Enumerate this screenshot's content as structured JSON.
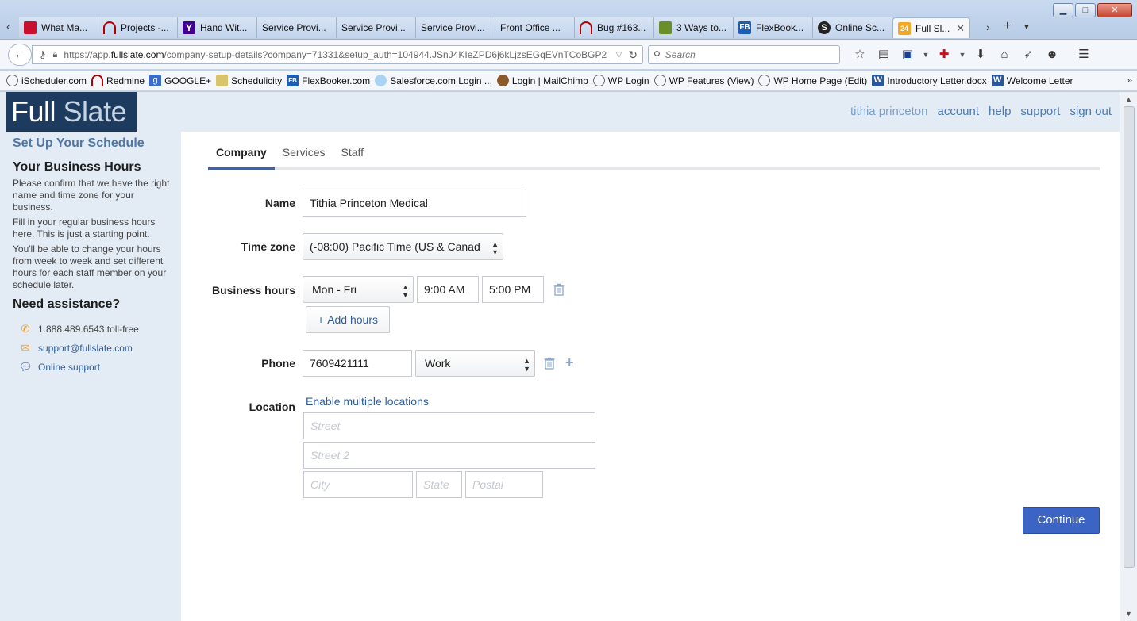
{
  "browser": {
    "tabs": [
      {
        "label": "What Ma...",
        "color": "#c8102e"
      },
      {
        "label": "Projects -...",
        "color": "#b40000"
      },
      {
        "label": "Hand Wit...",
        "color": "#410093"
      },
      {
        "label": "Service Provi...",
        "color": ""
      },
      {
        "label": "Service Provi...",
        "color": ""
      },
      {
        "label": "Service Provi...",
        "color": ""
      },
      {
        "label": "Front Office ...",
        "color": ""
      },
      {
        "label": "Bug #163...",
        "color": "#b40000"
      },
      {
        "label": "3 Ways to...",
        "color": "#6a8f2a"
      },
      {
        "label": "FlexBook...",
        "color": "#1a5fb4"
      },
      {
        "label": "Online Sc...",
        "color": "#222222"
      }
    ],
    "active_tab": {
      "label": "Full Sl...",
      "badge": "24"
    },
    "url": {
      "prefix": "https://app.",
      "domain": "fullslate.com",
      "path": "/company-setup-details?company=71331&setup_auth=104944.JSnJ4KIeZPD6j6kLjzsEGqEVnTCoBGP2"
    },
    "search_placeholder": "Search",
    "bookmarks": [
      {
        "label": "iScheduler.com"
      },
      {
        "label": "Redmine"
      },
      {
        "label": "GOOGLE+"
      },
      {
        "label": "Schedulicity"
      },
      {
        "label": "FlexBooker.com"
      },
      {
        "label": "Salesforce.com Login ..."
      },
      {
        "label": "Login | MailChimp"
      },
      {
        "label": "WP Login"
      },
      {
        "label": "WP Features (View)"
      },
      {
        "label": "WP Home Page (Edit)"
      },
      {
        "label": "Introductory Letter.docx"
      },
      {
        "label": "Welcome Letter"
      }
    ]
  },
  "app": {
    "logo_part1": "Full",
    "logo_part2": "Slate",
    "toplinks": {
      "user": "tithia princeton",
      "account": "account",
      "help": "help",
      "support": "support",
      "signout": "sign out"
    }
  },
  "sidebar": {
    "title": "Set Up Your Schedule",
    "heading": "Your Business Hours",
    "p1": "Please confirm that we have the right name and time zone for your business.",
    "p2": "Fill in your regular business hours here. This is just a starting point.",
    "p3": "You'll be able to change your hours from week to week and set different hours for each staff member on your schedule later.",
    "assist_heading": "Need assistance?",
    "phone": "1.888.489.6543 toll-free",
    "email": "support@fullslate.com",
    "online": "Online support"
  },
  "main": {
    "tabs": {
      "company": "Company",
      "services": "Services",
      "staff": "Staff"
    },
    "name_label": "Name",
    "name_value": "Tithia Princeton Medical",
    "timezone_label": "Time zone",
    "timezone_value": "(-08:00) Pacific Time (US & Canad",
    "hours_label": "Business hours",
    "days_value": "Mon - Fri",
    "start_time": "9:00 AM",
    "end_time": "5:00 PM",
    "add_hours": "Add hours",
    "phone_label": "Phone",
    "phone_value": "7609421111",
    "phone_type": "Work",
    "location_label": "Location",
    "enable_multi": "Enable multiple locations",
    "street_ph": "Street",
    "street2_ph": "Street 2",
    "city_ph": "City",
    "state_ph": "State",
    "postal_ph": "Postal",
    "continue": "Continue"
  },
  "colors": {
    "accent": "#3b64c5",
    "logo_bg": "#1c3b5f",
    "link": "#2f5d9a",
    "sidebar_bg": "#e3ebf5"
  }
}
